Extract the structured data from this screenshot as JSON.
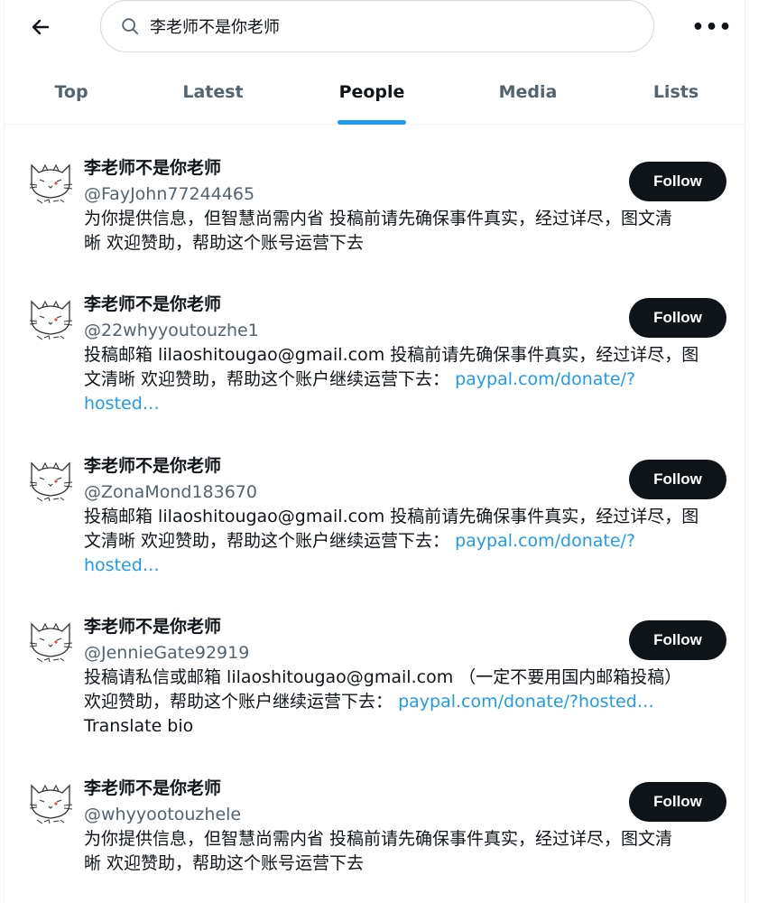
{
  "search": {
    "query": "李老师不是你老师"
  },
  "tabs": [
    {
      "label": "Top"
    },
    {
      "label": "Latest"
    },
    {
      "label": "People"
    },
    {
      "label": "Media"
    },
    {
      "label": "Lists"
    }
  ],
  "active_tab": "People",
  "more_label": "•••",
  "users": [
    {
      "name": "李老师不是你老师",
      "handle": "@FayJohn77244465",
      "bio_line1": "为你提供信息，但智慧尚需内省 投稿前请先确保事件真实，经过详尽，图文清",
      "bio_line2": "晰 欢迎赞助，帮助这个账号运营下去",
      "bio_link": "",
      "bio_line3": "",
      "follow_label": "Follow"
    },
    {
      "name": "李老师不是你老师",
      "handle": "@22whyyoutouzhe1",
      "bio_line1": "投稿邮箱 lilaoshitougao@gmail.com 投稿前请先确保事件真实，经过详尽，图",
      "bio_line2": "文清晰 欢迎赞助，帮助这个账户继续运营下去：",
      "bio_link": "paypal.com/donate/?",
      "bio_line3": "hosted…",
      "follow_label": "Follow"
    },
    {
      "name": "李老师不是你老师",
      "handle": "@ZonaMond183670",
      "bio_line1": "投稿邮箱 lilaoshitougao@gmail.com 投稿前请先确保事件真实，经过详尽，图",
      "bio_line2": "文清晰 欢迎赞助，帮助这个账户继续运营下去：",
      "bio_link": "paypal.com/donate/?",
      "bio_line3": "hosted…",
      "follow_label": "Follow"
    },
    {
      "name": "李老师不是你老师",
      "handle": "@JennieGate92919",
      "bio_line1": "投稿请私信或邮箱 lilaoshitougao@gmail.com （一定不要用国内邮箱投稿）",
      "bio_line2": "欢迎赞助，帮助这个账户继续运营下去：",
      "bio_link": "paypal.com/donate/?hosted…",
      "bio_line3": "Translate bio",
      "follow_label": "Follow"
    },
    {
      "name": "李老师不是你老师",
      "handle": "@whyyootouzhele",
      "bio_line1": "为你提供信息，但智慧尚需内省 投稿前请先确保事件真实，经过详尽，图文清",
      "bio_line2": "晰 欢迎赞助，帮助这个账号运营下去",
      "bio_link": "",
      "bio_line3": "",
      "follow_label": "Follow"
    }
  ],
  "colors": {
    "accent": "#1d9bf0",
    "text": "#0f1419",
    "muted": "#536471",
    "button": "#0f1419"
  }
}
